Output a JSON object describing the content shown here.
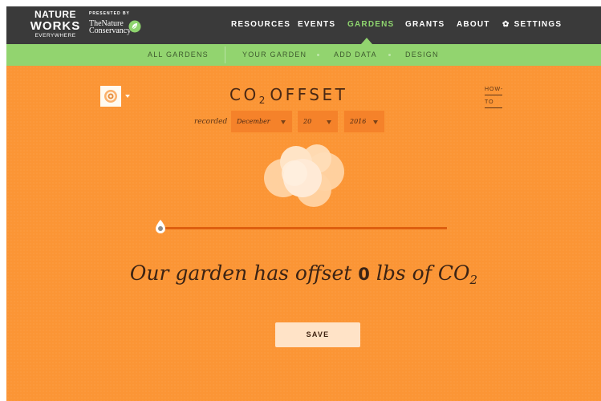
{
  "brand": {
    "line1": "NATURE",
    "line2": "WORKS",
    "line3": "EVERYWHERE",
    "presented_by": "PRESENTED BY",
    "partner_line1": "TheNature",
    "partner_line2": "Conservancy"
  },
  "nav": {
    "items": [
      {
        "label": "RESOURCES"
      },
      {
        "label": "EVENTS"
      },
      {
        "label": "GARDENS"
      },
      {
        "label": "GRANTS"
      },
      {
        "label": "ABOUT"
      },
      {
        "label": "SETTINGS",
        "icon": "gear-icon"
      }
    ],
    "active": "GARDENS",
    "active_color": "#8ed46e"
  },
  "subnav": {
    "items": [
      {
        "label": "ALL GARDENS"
      },
      {
        "label": "YOUR GARDEN"
      },
      {
        "label": "ADD DATA"
      },
      {
        "label": "DESIGN"
      }
    ],
    "background": "#92d46f"
  },
  "page": {
    "title_main": "CO",
    "title_sub": "2",
    "title_rest": "OFFSET",
    "howto_line1": "HOW-",
    "howto_line2": "TO",
    "recorded_label": "recorded",
    "month": "December",
    "day": "20",
    "year": "2016",
    "slider_value": 0,
    "sentence_before": "Our garden has offset",
    "offset_value": "0",
    "sentence_after": "lbs of CO",
    "sentence_sub": "2",
    "save_label": "SAVE",
    "background": "#fb9535"
  }
}
